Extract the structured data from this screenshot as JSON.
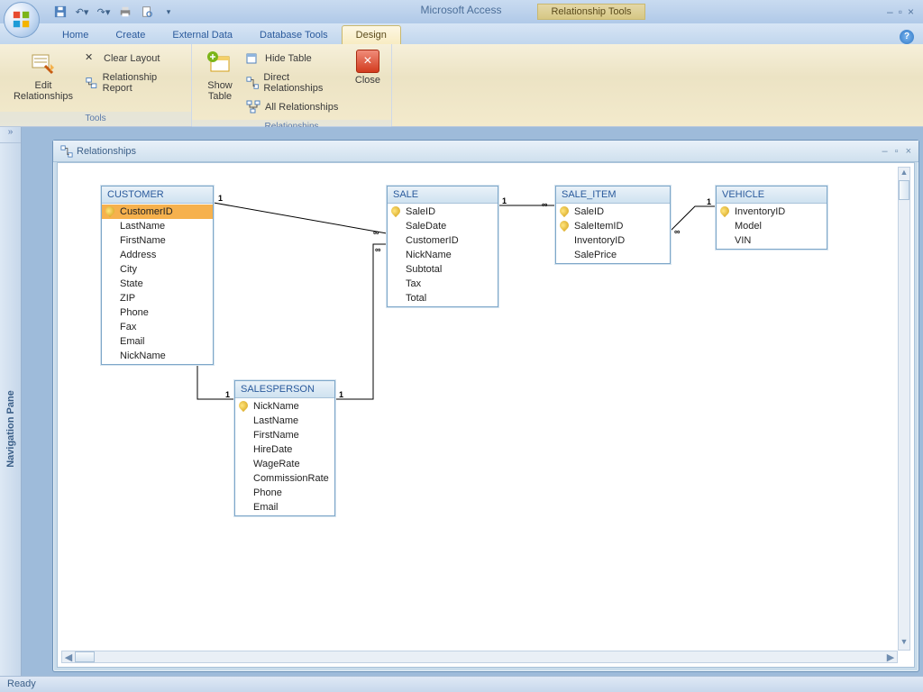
{
  "app_title": "Microsoft Access",
  "contextual_tab_header": "Relationship Tools",
  "tabs": {
    "home": "Home",
    "create": "Create",
    "external": "External Data",
    "dbtools": "Database Tools",
    "design": "Design"
  },
  "ribbon": {
    "tools_group": "Tools",
    "rel_group": "Relationships",
    "edit_rel": "Edit Relationships",
    "clear_layout": "Clear Layout",
    "rel_report": "Relationship Report",
    "show_table": "Show Table",
    "hide_table": "Hide Table",
    "direct_rel": "Direct Relationships",
    "all_rel": "All Relationships",
    "close": "Close"
  },
  "nav_pane_label": "Navigation Pane",
  "window_title": "Relationships",
  "status": "Ready",
  "tables": {
    "customer": {
      "name": "CUSTOMER",
      "fields": [
        "CustomerID",
        "LastName",
        "FirstName",
        "Address",
        "City",
        "State",
        "ZIP",
        "Phone",
        "Fax",
        "Email",
        "NickName"
      ]
    },
    "sale": {
      "name": "SALE",
      "fields": [
        "SaleID",
        "SaleDate",
        "CustomerID",
        "NickName",
        "Subtotal",
        "Tax",
        "Total"
      ]
    },
    "sale_item": {
      "name": "SALE_ITEM",
      "fields": [
        "SaleID",
        "SaleItemID",
        "InventoryID",
        "SalePrice"
      ]
    },
    "vehicle": {
      "name": "VEHICLE",
      "fields": [
        "InventoryID",
        "Model",
        "VIN"
      ]
    },
    "salesperson": {
      "name": "SALESPERSON",
      "fields": [
        "NickName",
        "LastName",
        "FirstName",
        "HireDate",
        "WageRate",
        "CommissionRate",
        "Phone",
        "Email"
      ]
    }
  },
  "cardinality": {
    "one": "1",
    "many": "∞"
  },
  "chart_data": {
    "type": "table",
    "title": "Relationships",
    "entities": [
      {
        "name": "CUSTOMER",
        "pk": [
          "CustomerID"
        ],
        "fields": [
          "CustomerID",
          "LastName",
          "FirstName",
          "Address",
          "City",
          "State",
          "ZIP",
          "Phone",
          "Fax",
          "Email",
          "NickName"
        ]
      },
      {
        "name": "SALE",
        "pk": [
          "SaleID"
        ],
        "fields": [
          "SaleID",
          "SaleDate",
          "CustomerID",
          "NickName",
          "Subtotal",
          "Tax",
          "Total"
        ]
      },
      {
        "name": "SALE_ITEM",
        "pk": [
          "SaleID",
          "SaleItemID"
        ],
        "fields": [
          "SaleID",
          "SaleItemID",
          "InventoryID",
          "SalePrice"
        ]
      },
      {
        "name": "VEHICLE",
        "pk": [
          "InventoryID"
        ],
        "fields": [
          "InventoryID",
          "Model",
          "VIN"
        ]
      },
      {
        "name": "SALESPERSON",
        "pk": [
          "NickName"
        ],
        "fields": [
          "NickName",
          "LastName",
          "FirstName",
          "HireDate",
          "WageRate",
          "CommissionRate",
          "Phone",
          "Email"
        ]
      }
    ],
    "relationships": [
      {
        "from": "CUSTOMER.CustomerID",
        "to": "SALE.CustomerID",
        "cardinality": "1-∞"
      },
      {
        "from": "CUSTOMER.NickName",
        "to": "SALESPERSON.NickName",
        "cardinality": "∞-1"
      },
      {
        "from": "SALESPERSON.NickName",
        "to": "SALE.NickName",
        "cardinality": "1-∞"
      },
      {
        "from": "SALE.SaleID",
        "to": "SALE_ITEM.SaleID",
        "cardinality": "1-∞"
      },
      {
        "from": "SALE_ITEM.InventoryID",
        "to": "VEHICLE.InventoryID",
        "cardinality": "∞-1"
      }
    ]
  }
}
